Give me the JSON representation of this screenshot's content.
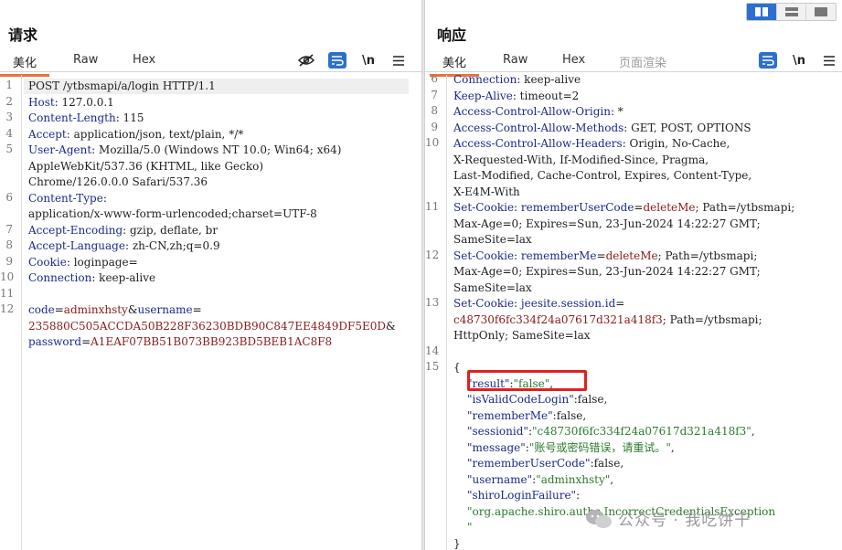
{
  "request": {
    "title": "请求",
    "tabs": [
      {
        "label": "美化",
        "active": true
      },
      {
        "label": "Raw",
        "active": false
      },
      {
        "label": "Hex",
        "active": false
      }
    ],
    "tools": {
      "hide_icon": "eye-slash-icon",
      "wrap_icon": "wrap-lines-icon",
      "newline_label": "\\n",
      "menu_icon": "hamburger-menu-icon"
    },
    "line_numbers": [
      "1",
      "2",
      "3",
      "4",
      "5",
      "",
      "",
      "6",
      "",
      "7",
      "8",
      "9",
      "10",
      "11",
      "12",
      "",
      ""
    ],
    "lines": [
      {
        "k": "",
        "v": "POST /ytbsmapi/a/login HTTP/1.1"
      },
      {
        "k": "Host",
        "v": ": 127.0.0.1"
      },
      {
        "k": "Content-Length",
        "v": ": 115"
      },
      {
        "k": "Accept",
        "v": ": application/json, text/plain, */*"
      },
      {
        "k": "User-Agent",
        "v": ": Mozilla/5.0 (Windows NT 10.0; Win64; x64)"
      },
      {
        "k": "",
        "v": "AppleWebKit/537.36 (KHTML, like Gecko)"
      },
      {
        "k": "",
        "v": "Chrome/126.0.0.0 Safari/537.36"
      },
      {
        "k": "Content-Type",
        "v": ":"
      },
      {
        "k": "",
        "v": "application/x-www-form-urlencoded;charset=UTF-8"
      },
      {
        "k": "Accept-Encoding",
        "v": ": gzip, deflate, br"
      },
      {
        "k": "Accept-Language",
        "v": ": zh-CN,zh;q=0.9"
      },
      {
        "k": "Cookie",
        "v": ": loginpage="
      },
      {
        "k": "Connection",
        "v": ": keep-alive"
      },
      {
        "k": "",
        "v": ""
      },
      {
        "k": "code",
        "v": "adminxhsty",
        "sep": "=",
        "amp": "&",
        "k2": "username",
        "sep2": "="
      },
      {
        "k": "",
        "v": "235880C505ACCDA50B228F36230BDB90C847EE4849DF5E0D",
        "amp": "&"
      },
      {
        "k": "password",
        "sep": "=",
        "v": "A1EAF07BB51B073BB923BD5BEB1AC8F8"
      }
    ]
  },
  "response": {
    "title": "响应",
    "tabs": [
      {
        "label": "美化",
        "active": true
      },
      {
        "label": "Raw",
        "active": false
      },
      {
        "label": "Hex",
        "active": false
      },
      {
        "label": "页面渲染",
        "active": false
      }
    ],
    "tools": {
      "wrap_icon": "wrap-lines-icon",
      "newline_label": "\\n",
      "menu_icon": "hamburger-menu-icon"
    },
    "line_numbers": [
      "6",
      "7",
      "8",
      "9",
      "10",
      "",
      "",
      "",
      "11",
      "",
      "",
      "12",
      "",
      "",
      "13",
      "",
      "",
      "14",
      "15",
      "",
      "",
      "",
      "",
      "",
      "",
      "",
      "",
      "",
      "",
      ""
    ],
    "headers": [
      {
        "k": "Connection",
        "v": ": keep-alive"
      },
      {
        "k": "Keep-Alive",
        "v": ": timeout=2"
      },
      {
        "k": "Access-Control-Allow-Origin",
        "v": ": *"
      },
      {
        "k": "Access-Control-Allow-Methods",
        "v": ": GET, POST, OPTIONS"
      },
      {
        "k": "Access-Control-Allow-Headers",
        "v": ": Origin, No-Cache,"
      },
      {
        "k": "",
        "v": "X-Requested-With, If-Modified-Since, Pragma,"
      },
      {
        "k": "",
        "v": "Last-Modified, Cache-Control, Expires, Content-Type,"
      },
      {
        "k": "",
        "v": "X-E4M-With"
      }
    ],
    "cookies": [
      {
        "line1_k": "Set-Cookie",
        "name": "rememberUserCode",
        "value": "deleteMe",
        "rest": "; Path=/ytbsmapi;",
        "line2": "Max-Age=0; Expires=Sun, 23-Jun-2024 14:22:27 GMT;",
        "line3": "SameSite=lax"
      },
      {
        "line1_k": "Set-Cookie",
        "name": "rememberMe",
        "value": "deleteMe",
        "rest": "; Path=/ytbsmapi;",
        "line2": "Max-Age=0; Expires=Sun, 23-Jun-2024 14:22:27 GMT;",
        "line3": "SameSite=lax"
      },
      {
        "line1_k": "Set-Cookie",
        "name": "jeesite.session.id",
        "value": "",
        "rest": "",
        "line2_val": "c48730f6fc334f24a07617d321a418f3",
        "line2": "; Path=/ytbsmapi;",
        "line3": "HttpOnly; SameSite=lax"
      }
    ],
    "json_open": "{",
    "json_close": "}",
    "json": [
      {
        "key": "\"result\"",
        "sep": ":",
        "val": "\"false\"",
        "tail": ","
      },
      {
        "key": "\"isValidCodeLogin\"",
        "sep": ":",
        "val": "false",
        "tail": ","
      },
      {
        "key": "\"rememberMe\"",
        "sep": ":",
        "val": "false",
        "tail": ","
      },
      {
        "key": "\"sessionid\"",
        "sep": ":",
        "val": "\"c48730f6fc334f24a07617d321a418f3\"",
        "tail": ","
      },
      {
        "key": "\"message\"",
        "sep": ":",
        "val": "\"账号或密码错误，请重试。\"",
        "tail": ","
      },
      {
        "key": "\"rememberUserCode\"",
        "sep": ":",
        "val": "false",
        "tail": ","
      },
      {
        "key": "\"username\"",
        "sep": ":",
        "val": "\"adminxhsty\"",
        "tail": ","
      },
      {
        "key": "\"shiroLoginFailure\"",
        "sep": ":",
        "val": "",
        "tail": ""
      },
      {
        "key": "",
        "sep": "",
        "val": "\"org.apache.shiro.authc.IncorrectCredentialsException",
        "tail": ""
      },
      {
        "key": "",
        "sep": "",
        "val": "\"",
        "tail": ""
      }
    ]
  },
  "watermark": {
    "text": "公众号 · 我吃饼干",
    "icon": "wechat-icon"
  },
  "view_toggle": {
    "icons": [
      "split-view-icon",
      "horizontal-view-icon",
      "single-view-icon"
    ]
  },
  "colors": {
    "accent_blue": "#2d6fd0",
    "tab_underline": "#e8743b",
    "highlight_box": "#e02020"
  }
}
